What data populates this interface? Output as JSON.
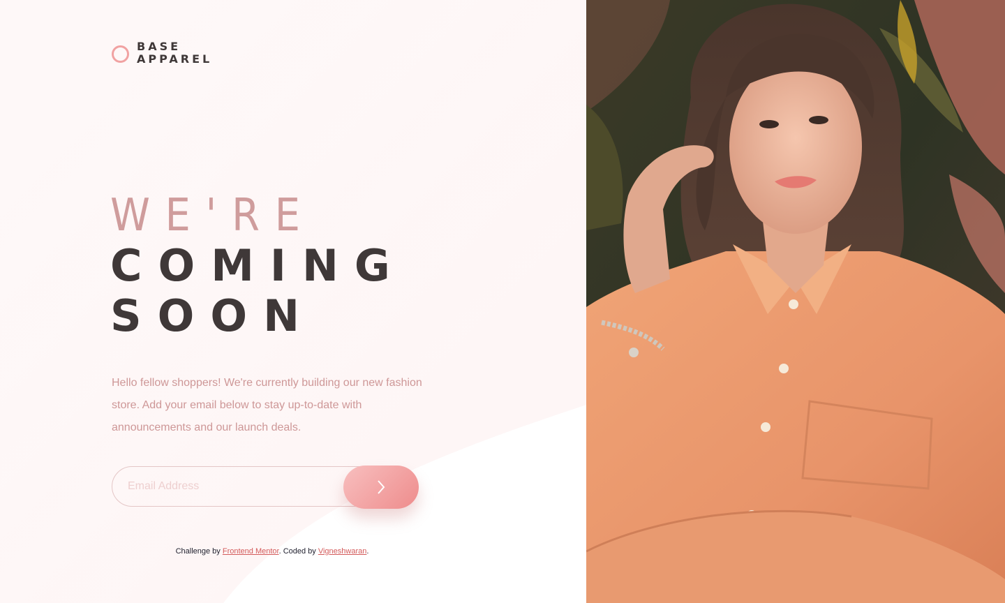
{
  "brand": {
    "line1": "BASE",
    "line2": "APPAREL"
  },
  "hero": {
    "line1": "WE'RE",
    "line2": "COMING",
    "line3": "SOON",
    "description": "Hello fellow shoppers! We're currently building our new fashion store. Add your email below to stay up-to-date with announcements and our launch deals."
  },
  "form": {
    "email_placeholder": "Email Address",
    "submit_icon": "chevron-right-icon"
  },
  "footer": {
    "prefix": "Challenge by ",
    "link1": "Frontend Mentor",
    "middle": ". Coded by ",
    "link2": "Vigneshwaran",
    "suffix": "."
  },
  "colors": {
    "accent": "#f1a2a2",
    "heading_light": "#cf9c9c",
    "heading_dark": "#3f3838",
    "body_text": "#ce9797",
    "shirt": "#e8946a"
  },
  "photo": {
    "subject": "hero-model-photo"
  }
}
